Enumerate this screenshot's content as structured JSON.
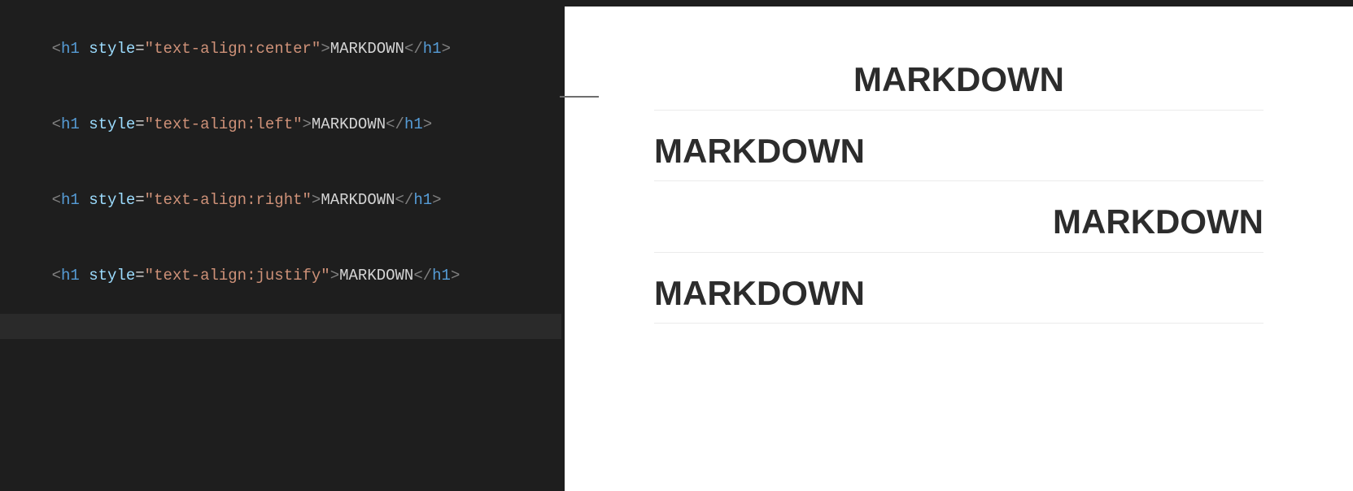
{
  "editor": {
    "lines": [
      {
        "tag": "h1",
        "attrName": "style",
        "attrValue": "text-align:center",
        "inner": "MARKDOWN"
      },
      {
        "tag": "h1",
        "attrName": "style",
        "attrValue": "text-align:left",
        "inner": "MARKDOWN"
      },
      {
        "tag": "h1",
        "attrName": "style",
        "attrValue": "text-align:right",
        "inner": "MARKDOWN"
      },
      {
        "tag": "h1",
        "attrName": "style",
        "attrValue": "text-align:justify",
        "inner": "MARKDOWN"
      }
    ]
  },
  "preview": {
    "headings": [
      {
        "text": "MARKDOWN",
        "align": "center"
      },
      {
        "text": "MARKDOWN",
        "align": "left"
      },
      {
        "text": "MARKDOWN",
        "align": "right"
      },
      {
        "text": "MARKDOWN",
        "align": "justify"
      }
    ]
  }
}
